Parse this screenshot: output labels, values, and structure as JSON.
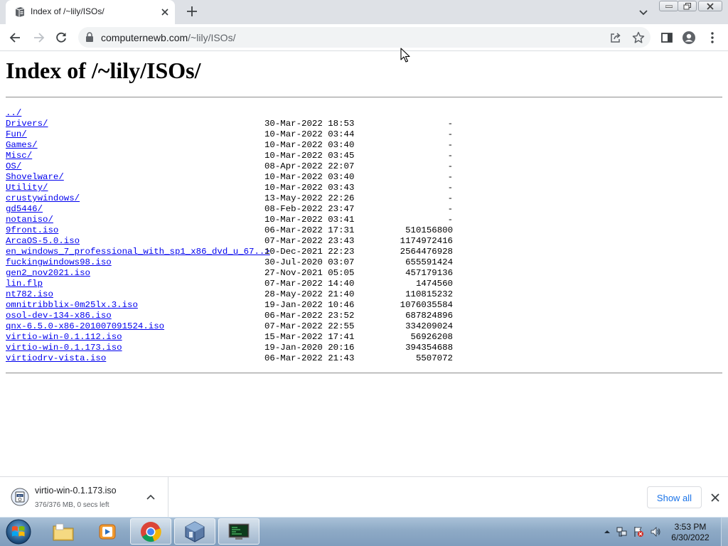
{
  "browser": {
    "tab": {
      "title": "Index of /~lily/ISOs/"
    },
    "address": {
      "host": "computernewb.com",
      "path": "/~lily/ISOs/"
    }
  },
  "page": {
    "heading": "Index of /~lily/ISOs/",
    "parent_link": "../",
    "entries": [
      {
        "name": "Drivers/",
        "date": "30-Mar-2022 18:53",
        "size": "-"
      },
      {
        "name": "Fun/",
        "date": "10-Mar-2022 03:44",
        "size": "-"
      },
      {
        "name": "Games/",
        "date": "10-Mar-2022 03:40",
        "size": "-"
      },
      {
        "name": "Misc/",
        "date": "10-Mar-2022 03:45",
        "size": "-"
      },
      {
        "name": "OS/",
        "date": "08-Apr-2022 22:07",
        "size": "-"
      },
      {
        "name": "Shovelware/",
        "date": "10-Mar-2022 03:40",
        "size": "-"
      },
      {
        "name": "Utility/",
        "date": "10-Mar-2022 03:43",
        "size": "-"
      },
      {
        "name": "crustywindows/",
        "date": "13-May-2022 22:26",
        "size": "-"
      },
      {
        "name": "gd5446/",
        "date": "08-Feb-2022 23:47",
        "size": "-"
      },
      {
        "name": "notaniso/",
        "date": "10-Mar-2022 03:41",
        "size": "-"
      },
      {
        "name": "9front.iso",
        "date": "06-Mar-2022 17:31",
        "size": "510156800"
      },
      {
        "name": "ArcaOS-5.0.iso",
        "date": "07-Mar-2022 23:43",
        "size": "1174972416"
      },
      {
        "name": "en_windows_7_professional_with_sp1_x86_dvd_u_67..>",
        "date": "10-Dec-2021 22:23",
        "size": "2564476928"
      },
      {
        "name": "fuckingwindows98.iso",
        "date": "30-Jul-2020 03:07",
        "size": "655591424"
      },
      {
        "name": "gen2_nov2021.iso",
        "date": "27-Nov-2021 05:05",
        "size": "457179136"
      },
      {
        "name": "lin.flp",
        "date": "07-Mar-2022 14:40",
        "size": "1474560"
      },
      {
        "name": "nt782.iso",
        "date": "28-May-2022 21:40",
        "size": "110815232"
      },
      {
        "name": "omnitribblix-0m25lx.3.iso",
        "date": "19-Jan-2022 10:46",
        "size": "1076035584"
      },
      {
        "name": "osol-dev-134-x86.iso",
        "date": "06-Mar-2022 23:52",
        "size": "687824896"
      },
      {
        "name": "qnx-6.5.0-x86-201007091524.iso",
        "date": "07-Mar-2022 22:55",
        "size": "334209024"
      },
      {
        "name": "virtio-win-0.1.112.iso",
        "date": "15-Mar-2022 17:41",
        "size": "56926208"
      },
      {
        "name": "virtio-win-0.1.173.iso",
        "date": "19-Jan-2020 20:16",
        "size": "394354688"
      },
      {
        "name": "virtiodrv-vista.iso",
        "date": "06-Mar-2022 21:43",
        "size": "5507072"
      }
    ]
  },
  "downloads": {
    "item": {
      "filename": "virtio-win-0.1.173.iso",
      "status": "376/376 MB, 0 secs left",
      "icon": "iso-file-icon"
    },
    "show_all": "Show all"
  },
  "taskbar": {
    "apps": [
      {
        "name": "windows-explorer-icon",
        "active": false
      },
      {
        "name": "media-player-icon",
        "active": false
      },
      {
        "name": "chrome-icon",
        "active": true
      },
      {
        "name": "virtualbox-icon",
        "active": true
      },
      {
        "name": "terminal-monitor-icon",
        "active": true
      }
    ],
    "clock": {
      "time": "3:53 PM",
      "date": "6/30/2022"
    }
  },
  "colors": {
    "link": "#0000ee",
    "show_all_text": "#1a73e8",
    "tab_strip": "#dee1e6"
  }
}
